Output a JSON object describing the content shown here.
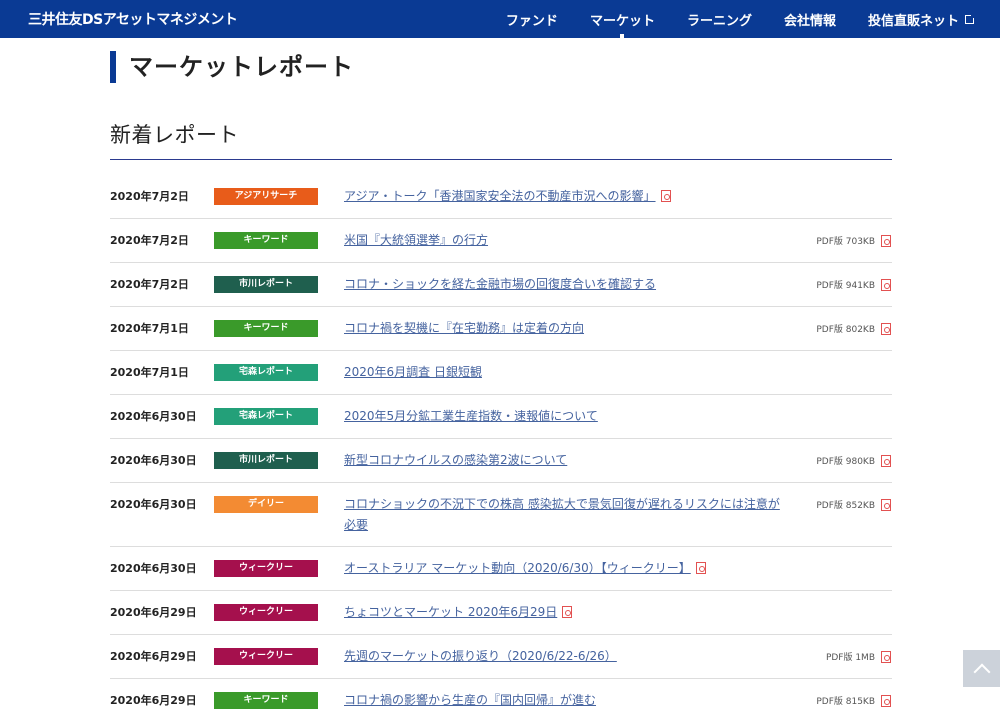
{
  "header": {
    "logo": "三井住友DSアセットマネジメント",
    "nav": [
      "ファンド",
      "マーケット",
      "ラーニング",
      "会社情報",
      "投信直販ネット"
    ]
  },
  "page_title": "マーケットレポート",
  "section_title": "新着レポート",
  "colors": {
    "header_bg": "#0a3a94",
    "アジアリサーチ": "#e85c1a",
    "キーワード": "#3a9a2a",
    "市川レポート": "#1f5f4e",
    "宅森レポート": "#23a079",
    "デイリー": "#f38b33",
    "ウィークリー": "#a5104d"
  },
  "reports": [
    {
      "date": "2020年7月2日",
      "tag": "アジアリサーチ",
      "color": "#e85c1a",
      "title": "アジア・トーク「香港国家安全法の不動産市況への影響」",
      "pdf": ""
    },
    {
      "date": "2020年7月2日",
      "tag": "キーワード",
      "color": "#3a9a2a",
      "title": "米国『大統領選挙』の行方",
      "pdf": "PDF版 703KB"
    },
    {
      "date": "2020年7月2日",
      "tag": "市川レポート",
      "color": "#1f5f4e",
      "title": "コロナ・ショックを経た金融市場の回復度合いを確認する",
      "pdf": "PDF版 941KB"
    },
    {
      "date": "2020年7月1日",
      "tag": "キーワード",
      "color": "#3a9a2a",
      "title": "コロナ禍を契機に『在宅勤務』は定着の方向",
      "pdf": "PDF版 802KB"
    },
    {
      "date": "2020年7月1日",
      "tag": "宅森レポート",
      "color": "#23a079",
      "title": "2020年6月調査 日銀短観",
      "pdf": ""
    },
    {
      "date": "2020年6月30日",
      "tag": "宅森レポート",
      "color": "#23a079",
      "title": "2020年5月分鉱工業生産指数・速報値について",
      "pdf": ""
    },
    {
      "date": "2020年6月30日",
      "tag": "市川レポート",
      "color": "#1f5f4e",
      "title": "新型コロナウイルスの感染第2波について",
      "pdf": "PDF版 980KB"
    },
    {
      "date": "2020年6月30日",
      "tag": "デイリー",
      "color": "#f38b33",
      "title": "コロナショックの不況下での株高 感染拡大で景気回復が遅れるリスクには注意が必要",
      "pdf": "PDF版 852KB"
    },
    {
      "date": "2020年6月30日",
      "tag": "ウィークリー",
      "color": "#a5104d",
      "title": "オーストラリア マーケット動向（2020/6/30）【ウィークリー】",
      "pdf": ""
    },
    {
      "date": "2020年6月29日",
      "tag": "ウィークリー",
      "color": "#a5104d",
      "title": "ちょコツとマーケット 2020年6月29日",
      "pdf": ""
    },
    {
      "date": "2020年6月29日",
      "tag": "ウィークリー",
      "color": "#a5104d",
      "title": "先週のマーケットの振り返り（2020/6/22-6/26）",
      "pdf": "PDF版 1MB"
    },
    {
      "date": "2020年6月29日",
      "tag": "キーワード",
      "color": "#3a9a2a",
      "title": "コロナ禍の影響から生産の『国内回帰』が進む",
      "pdf": "PDF版 815KB"
    }
  ],
  "inline_pdf_rows": [
    0,
    8,
    9
  ]
}
